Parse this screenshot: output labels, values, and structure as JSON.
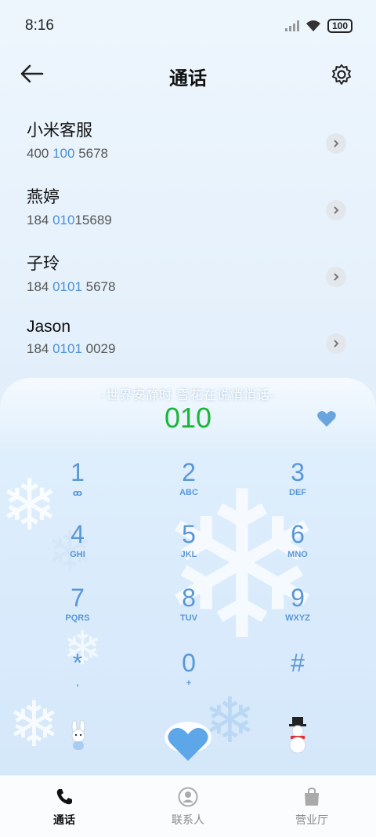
{
  "status": {
    "time": "8:16",
    "battery": "100"
  },
  "header": {
    "title": "通话"
  },
  "contacts": [
    {
      "name": "小米客服",
      "num_pre": "400 ",
      "num_hl": "100",
      "num_post": " 5678"
    },
    {
      "name": "燕婷",
      "num_pre": "184 ",
      "num_hl": "010",
      "num_post": "15689"
    },
    {
      "name": "子玲",
      "num_pre": "184 ",
      "num_hl": "0101",
      "num_post": " 5678"
    },
    {
      "name": "Jason",
      "num_pre": "184 ",
      "num_hl": "0101",
      "num_post": " 0029"
    }
  ],
  "dialer": {
    "slogan": "-世界安静时 雪花在说悄悄话-",
    "typed": "010",
    "keys": [
      {
        "d": "1",
        "l": "ꝏ"
      },
      {
        "d": "2",
        "l": "ABC"
      },
      {
        "d": "3",
        "l": "DEF"
      },
      {
        "d": "4",
        "l": "GHI"
      },
      {
        "d": "5",
        "l": "JKL"
      },
      {
        "d": "6",
        "l": "MNO"
      },
      {
        "d": "7",
        "l": "PQRS"
      },
      {
        "d": "8",
        "l": "TUV"
      },
      {
        "d": "9",
        "l": "WXYZ"
      },
      {
        "d": "*",
        "l": ","
      },
      {
        "d": "0",
        "l": "+"
      },
      {
        "d": "#",
        "l": ""
      }
    ]
  },
  "tabs": {
    "calls": "通话",
    "contacts": "联系人",
    "store": "营业厅"
  },
  "colors": {
    "accent": "#5a97d8",
    "typed": "#1bb53a",
    "highlight": "#4a8fd8"
  }
}
